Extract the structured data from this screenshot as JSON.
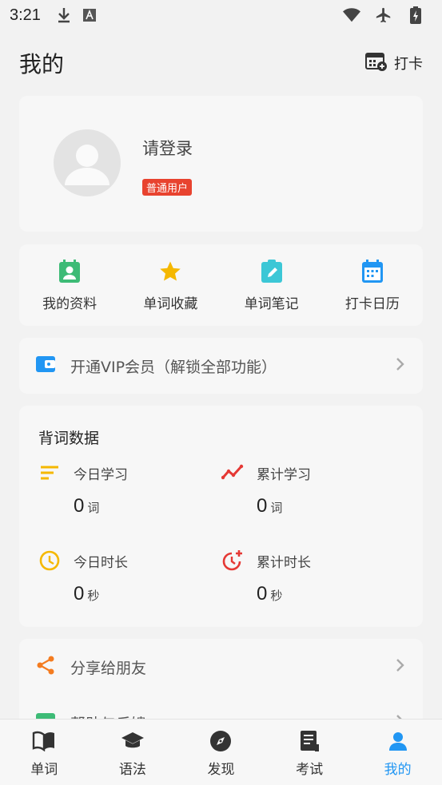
{
  "status_bar": {
    "time": "3:21"
  },
  "header": {
    "title": "我的",
    "checkin_label": "打卡"
  },
  "profile": {
    "login_text": "请登录",
    "badge": "普通用户"
  },
  "shortcuts": [
    {
      "label": "我的资料",
      "icon": "profile-card-icon",
      "color": "#3dbb76"
    },
    {
      "label": "单词收藏",
      "icon": "star-icon",
      "color": "#f5b800"
    },
    {
      "label": "单词笔记",
      "icon": "note-edit-icon",
      "color": "#3cc7d6"
    },
    {
      "label": "打卡日历",
      "icon": "calendar-icon",
      "color": "#2196f3"
    }
  ],
  "vip": {
    "label": "开通VIP会员（解锁全部功能）",
    "icon": "wallet-icon",
    "color": "#2196f3"
  },
  "stats": {
    "title": "背词数据",
    "items": [
      {
        "label": "今日学习",
        "value": "0",
        "unit": "词",
        "icon": "lines-icon",
        "color": "#f5b800"
      },
      {
        "label": "累计学习",
        "value": "0",
        "unit": "词",
        "icon": "trend-icon",
        "color": "#e53935"
      },
      {
        "label": "今日时长",
        "value": "0",
        "unit": "秒",
        "icon": "clock-icon",
        "color": "#f5b800"
      },
      {
        "label": "累计时长",
        "value": "0",
        "unit": "秒",
        "icon": "clock-plus-icon",
        "color": "#e53935"
      }
    ]
  },
  "menu": [
    {
      "label": "分享给朋友",
      "icon": "share-icon",
      "color": "#f47c20"
    },
    {
      "label": "帮助与反馈",
      "icon": "help-icon",
      "color": "#3dbb76"
    }
  ],
  "tabs": [
    {
      "label": "单词",
      "icon": "book-icon",
      "active": false
    },
    {
      "label": "语法",
      "icon": "graduation-cap-icon",
      "active": false
    },
    {
      "label": "发现",
      "icon": "compass-icon",
      "active": false
    },
    {
      "label": "考试",
      "icon": "exam-paper-icon",
      "active": false
    },
    {
      "label": "我的",
      "icon": "person-icon",
      "active": true
    }
  ],
  "colors": {
    "accent": "#2196f3",
    "badge": "#e8432f"
  }
}
